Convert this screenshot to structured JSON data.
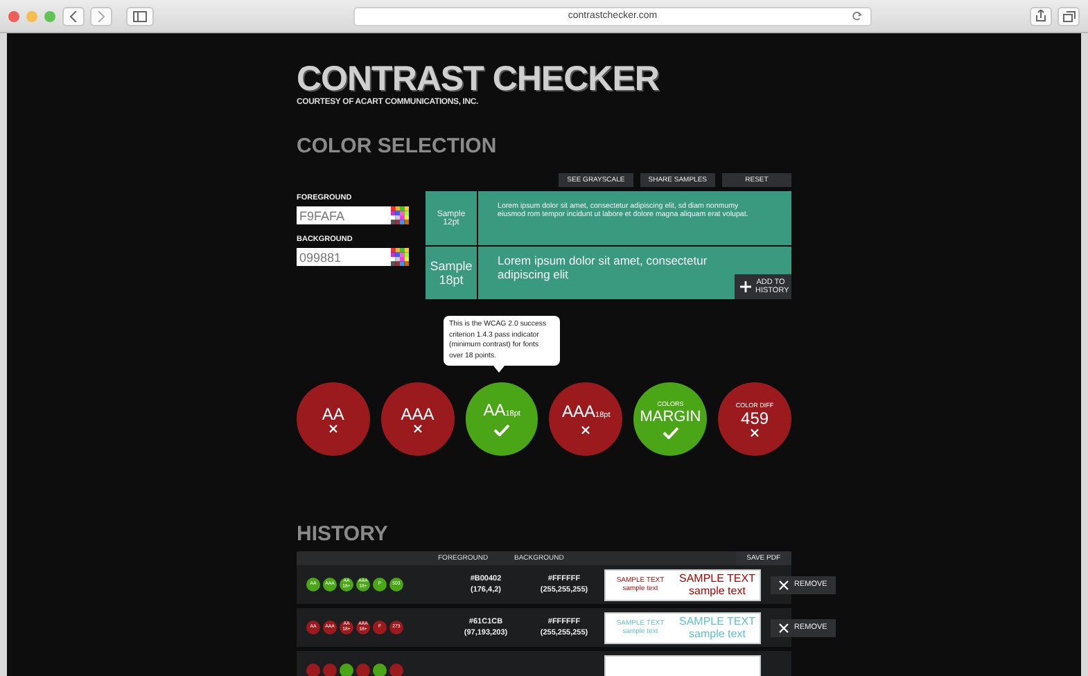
{
  "browser": {
    "url": "contrastchecker.com"
  },
  "header": {
    "title": "CONTRAST CHECKER",
    "subtitle": "COURTESY OF ACART COMMUNICATIONS, INC."
  },
  "color_selection": {
    "heading": "COLOR SELECTION",
    "buttons": [
      "SEE GRAYSCALE",
      "SHARE SAMPLES",
      "RESET"
    ],
    "fields": [
      {
        "label": "FOREGROUND",
        "value": "F9FAFA"
      },
      {
        "label": "BACKGROUND",
        "value": "099881"
      }
    ],
    "samples": [
      {
        "label": "Sample 12pt",
        "kind": "small",
        "text": "Lorem ipsum dolor sit amet, consectetur adipiscing elit, sd diam nonmumy eiusmod rom tempor incidunt ut labore et dolore magna aliquam erat volupat."
      },
      {
        "label": "Sample 18pt",
        "kind": "large",
        "text": "Lorem ipsum dolor sit amet, consectetur adipiscing elit"
      }
    ],
    "add_button": "ADD TO HISTORY"
  },
  "tooltip": "This is the WCAG 2.0 success criterion 1.4.3 pass indicator (minimum contrast) for fonts over 18 points.",
  "indicators": [
    {
      "main": "AA",
      "pass": false
    },
    {
      "main": "AAA",
      "pass": false
    },
    {
      "main": "AA",
      "suffix": "18pt",
      "pass": true
    },
    {
      "main": "AAA",
      "suffix": "18pt",
      "pass": false
    },
    {
      "caption": "COLORS",
      "main": "MARGIN",
      "pass": true
    },
    {
      "caption": "COLOR DIFF",
      "main": "459",
      "pass": false
    }
  ],
  "history": {
    "heading": "HISTORY",
    "columns": [
      "FOREGROUND",
      "BACKGROUND"
    ],
    "save_pdf": "SAVE PDF",
    "rows": [
      {
        "badges": [
          {
            "label": "AA",
            "pass": true
          },
          {
            "label": "AAA",
            "pass": true
          },
          {
            "label": "AA",
            "sub": "18+",
            "pass": true
          },
          {
            "label": "AAA",
            "sub": "18+",
            "pass": true
          },
          {
            "label": "P",
            "pass": true
          },
          {
            "label": "503",
            "pass": true
          }
        ],
        "foreground": [
          "#B00402",
          "(176,4,2)"
        ],
        "background": [
          "#FFFFFF",
          "(255,255,255)"
        ],
        "color": "#b00402",
        "samples": [
          "SAMPLE TEXT",
          "sample text",
          "SAMPLE TEXT",
          "sample text"
        ],
        "remove": "REMOVE"
      },
      {
        "badges": [
          {
            "label": "AA",
            "pass": false
          },
          {
            "label": "AAA",
            "pass": false
          },
          {
            "label": "AA",
            "sub": "18+",
            "pass": false
          },
          {
            "label": "AAA",
            "sub": "18+",
            "pass": false
          },
          {
            "label": "F",
            "pass": false
          },
          {
            "label": "273",
            "pass": false
          }
        ],
        "foreground": [
          "#61C1CB",
          "(97,193,203)"
        ],
        "background": [
          "#FFFFFF",
          "(255,255,255)"
        ],
        "color": "#61c1cb",
        "samples": [
          "SAMPLE TEXT",
          "sample text",
          "SAMPLE TEXT",
          "sample text"
        ],
        "remove": "REMOVE"
      },
      {
        "badges": [
          {
            "pass": false
          },
          {
            "pass": false
          },
          {
            "pass": true
          },
          {
            "pass": false
          },
          {
            "pass": true
          },
          {
            "pass": false
          }
        ]
      }
    ]
  }
}
